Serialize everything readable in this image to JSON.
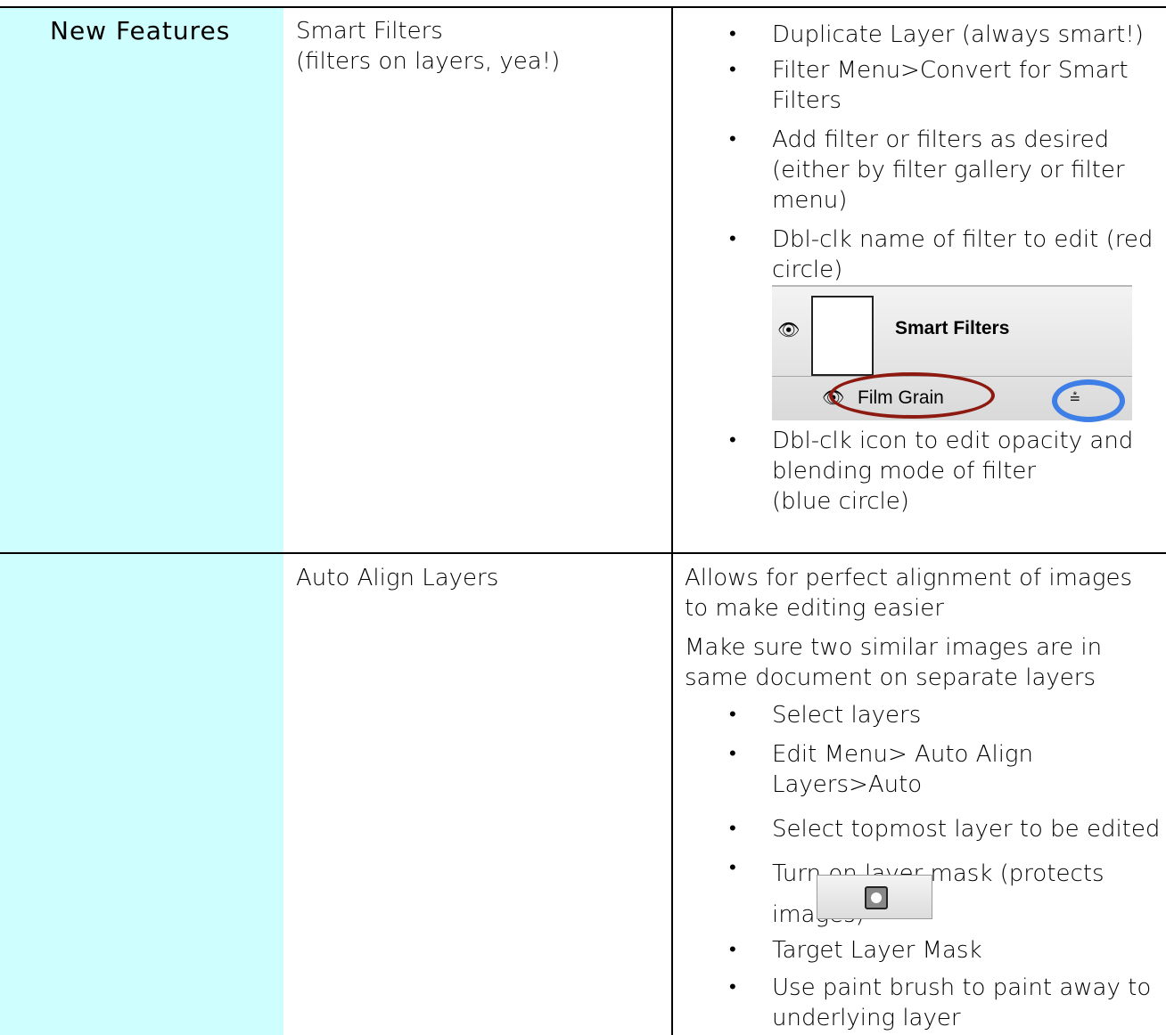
{
  "colors": {
    "first_column_bg": "#cffefe",
    "red_circle": "#8d1a10",
    "blue_circle": "#3d7fe6"
  },
  "row1": {
    "category": "New Features",
    "feature_line1": "Smart Filters",
    "feature_line2": "(filters on layers, yea!)",
    "bullets": [
      "Duplicate Layer (always smart!)",
      "Filter Menu>Convert for Smart Filters",
      "Add filter or filters as desired (either by filter gallery or filter menu)",
      "Dbl-clk name of filter to edit (red circle)",
      "Dbl-clk icon to edit opacity and blending mode of filter\n(blue circle)"
    ],
    "panel": {
      "smart_filters_label": "Smart Filters",
      "filter_name": "Film Grain",
      "eye_icon": "eye-icon",
      "options_icon": "filter-blending-options-icon"
    }
  },
  "row2": {
    "feature": "Auto Align Layers",
    "para1": "Allows for perfect alignment of images to make editing easier",
    "para2": "Make sure two similar images are in same document on separate layers",
    "bullets": [
      "Select layers",
      "Edit Menu> Auto Align Layers>Auto",
      "Select topmost layer to be edited",
      "Turn on layer mask (protects images)",
      "Target Layer Mask",
      "Use paint brush to paint away to underlying layer"
    ],
    "mask_icon": "layer-mask-icon"
  }
}
